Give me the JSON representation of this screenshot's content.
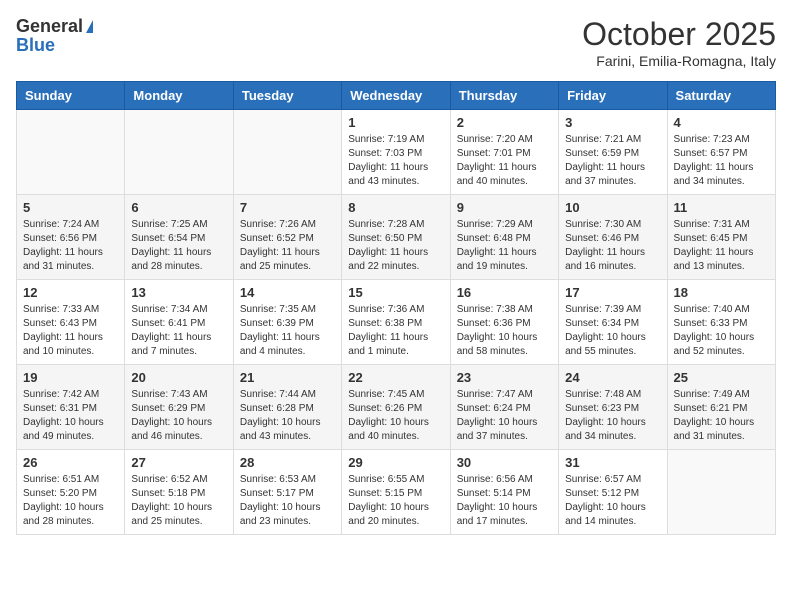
{
  "logo": {
    "general": "General",
    "blue": "Blue"
  },
  "title": "October 2025",
  "subtitle": "Farini, Emilia-Romagna, Italy",
  "days_of_week": [
    "Sunday",
    "Monday",
    "Tuesday",
    "Wednesday",
    "Thursday",
    "Friday",
    "Saturday"
  ],
  "weeks": [
    [
      {
        "day": "",
        "info": ""
      },
      {
        "day": "",
        "info": ""
      },
      {
        "day": "",
        "info": ""
      },
      {
        "day": "1",
        "info": "Sunrise: 7:19 AM\nSunset: 7:03 PM\nDaylight: 11 hours and 43 minutes."
      },
      {
        "day": "2",
        "info": "Sunrise: 7:20 AM\nSunset: 7:01 PM\nDaylight: 11 hours and 40 minutes."
      },
      {
        "day": "3",
        "info": "Sunrise: 7:21 AM\nSunset: 6:59 PM\nDaylight: 11 hours and 37 minutes."
      },
      {
        "day": "4",
        "info": "Sunrise: 7:23 AM\nSunset: 6:57 PM\nDaylight: 11 hours and 34 minutes."
      }
    ],
    [
      {
        "day": "5",
        "info": "Sunrise: 7:24 AM\nSunset: 6:56 PM\nDaylight: 11 hours and 31 minutes."
      },
      {
        "day": "6",
        "info": "Sunrise: 7:25 AM\nSunset: 6:54 PM\nDaylight: 11 hours and 28 minutes."
      },
      {
        "day": "7",
        "info": "Sunrise: 7:26 AM\nSunset: 6:52 PM\nDaylight: 11 hours and 25 minutes."
      },
      {
        "day": "8",
        "info": "Sunrise: 7:28 AM\nSunset: 6:50 PM\nDaylight: 11 hours and 22 minutes."
      },
      {
        "day": "9",
        "info": "Sunrise: 7:29 AM\nSunset: 6:48 PM\nDaylight: 11 hours and 19 minutes."
      },
      {
        "day": "10",
        "info": "Sunrise: 7:30 AM\nSunset: 6:46 PM\nDaylight: 11 hours and 16 minutes."
      },
      {
        "day": "11",
        "info": "Sunrise: 7:31 AM\nSunset: 6:45 PM\nDaylight: 11 hours and 13 minutes."
      }
    ],
    [
      {
        "day": "12",
        "info": "Sunrise: 7:33 AM\nSunset: 6:43 PM\nDaylight: 11 hours and 10 minutes."
      },
      {
        "day": "13",
        "info": "Sunrise: 7:34 AM\nSunset: 6:41 PM\nDaylight: 11 hours and 7 minutes."
      },
      {
        "day": "14",
        "info": "Sunrise: 7:35 AM\nSunset: 6:39 PM\nDaylight: 11 hours and 4 minutes."
      },
      {
        "day": "15",
        "info": "Sunrise: 7:36 AM\nSunset: 6:38 PM\nDaylight: 11 hours and 1 minute."
      },
      {
        "day": "16",
        "info": "Sunrise: 7:38 AM\nSunset: 6:36 PM\nDaylight: 10 hours and 58 minutes."
      },
      {
        "day": "17",
        "info": "Sunrise: 7:39 AM\nSunset: 6:34 PM\nDaylight: 10 hours and 55 minutes."
      },
      {
        "day": "18",
        "info": "Sunrise: 7:40 AM\nSunset: 6:33 PM\nDaylight: 10 hours and 52 minutes."
      }
    ],
    [
      {
        "day": "19",
        "info": "Sunrise: 7:42 AM\nSunset: 6:31 PM\nDaylight: 10 hours and 49 minutes."
      },
      {
        "day": "20",
        "info": "Sunrise: 7:43 AM\nSunset: 6:29 PM\nDaylight: 10 hours and 46 minutes."
      },
      {
        "day": "21",
        "info": "Sunrise: 7:44 AM\nSunset: 6:28 PM\nDaylight: 10 hours and 43 minutes."
      },
      {
        "day": "22",
        "info": "Sunrise: 7:45 AM\nSunset: 6:26 PM\nDaylight: 10 hours and 40 minutes."
      },
      {
        "day": "23",
        "info": "Sunrise: 7:47 AM\nSunset: 6:24 PM\nDaylight: 10 hours and 37 minutes."
      },
      {
        "day": "24",
        "info": "Sunrise: 7:48 AM\nSunset: 6:23 PM\nDaylight: 10 hours and 34 minutes."
      },
      {
        "day": "25",
        "info": "Sunrise: 7:49 AM\nSunset: 6:21 PM\nDaylight: 10 hours and 31 minutes."
      }
    ],
    [
      {
        "day": "26",
        "info": "Sunrise: 6:51 AM\nSunset: 5:20 PM\nDaylight: 10 hours and 28 minutes."
      },
      {
        "day": "27",
        "info": "Sunrise: 6:52 AM\nSunset: 5:18 PM\nDaylight: 10 hours and 25 minutes."
      },
      {
        "day": "28",
        "info": "Sunrise: 6:53 AM\nSunset: 5:17 PM\nDaylight: 10 hours and 23 minutes."
      },
      {
        "day": "29",
        "info": "Sunrise: 6:55 AM\nSunset: 5:15 PM\nDaylight: 10 hours and 20 minutes."
      },
      {
        "day": "30",
        "info": "Sunrise: 6:56 AM\nSunset: 5:14 PM\nDaylight: 10 hours and 17 minutes."
      },
      {
        "day": "31",
        "info": "Sunrise: 6:57 AM\nSunset: 5:12 PM\nDaylight: 10 hours and 14 minutes."
      },
      {
        "day": "",
        "info": ""
      }
    ]
  ]
}
